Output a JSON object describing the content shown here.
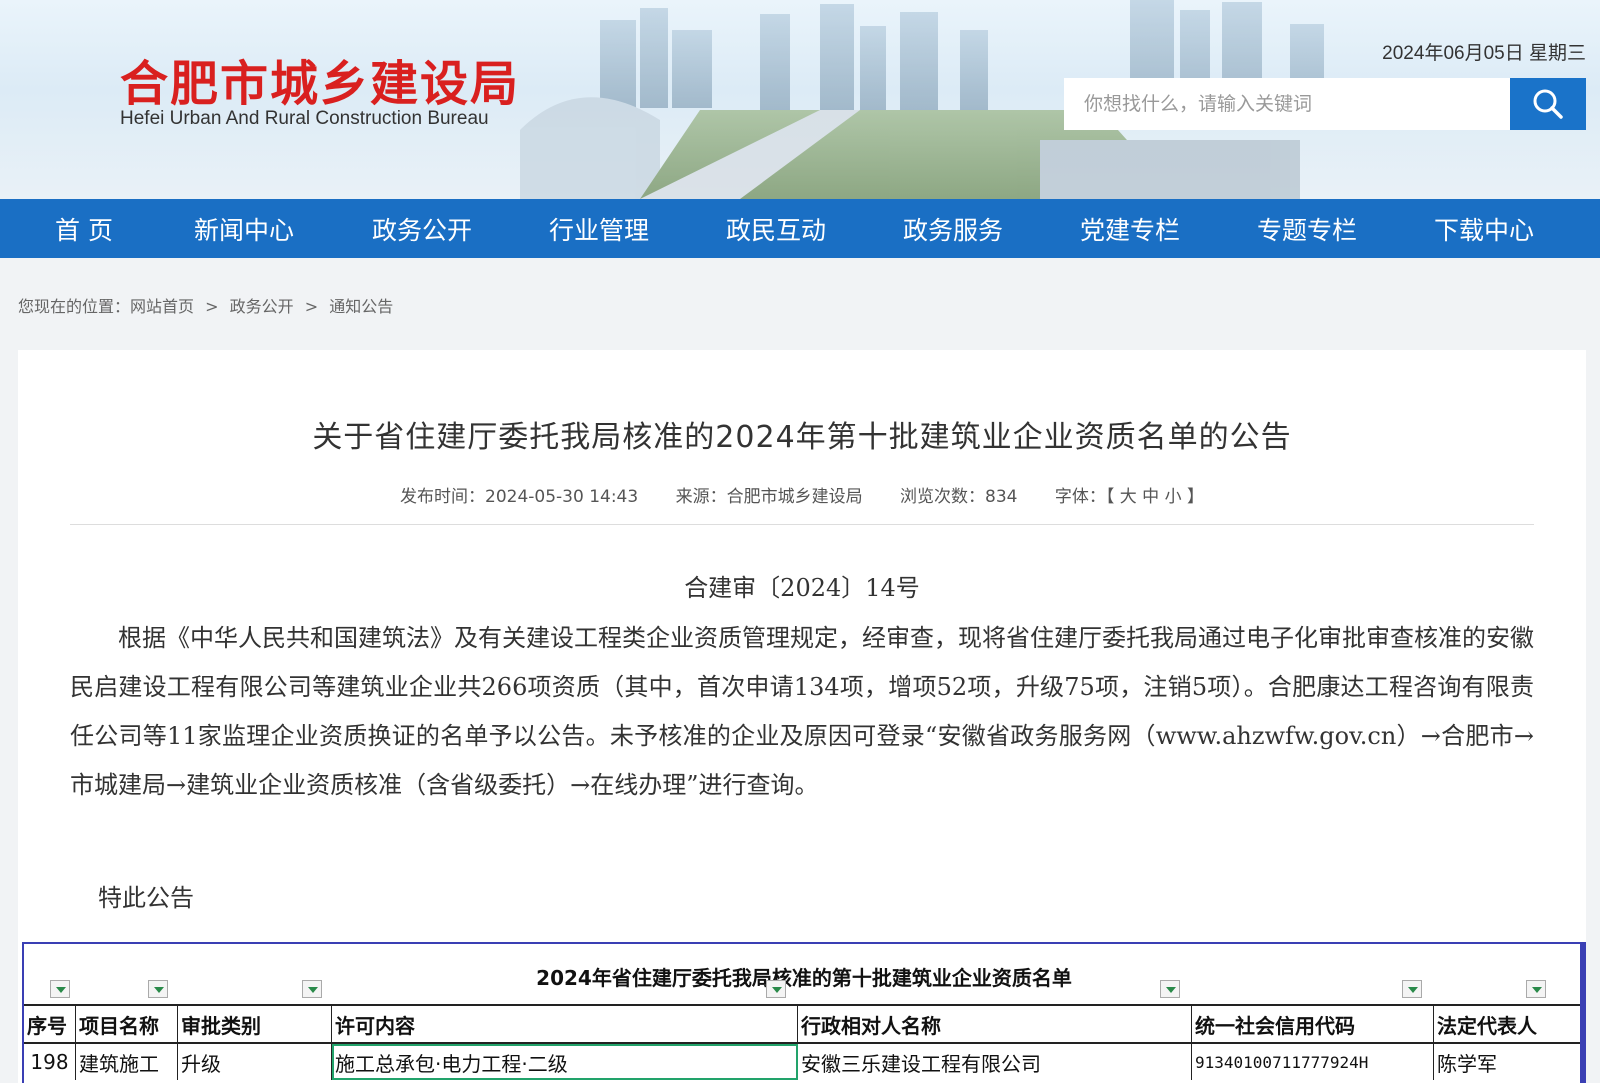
{
  "header": {
    "logo_cn": "合肥市城乡建设局",
    "logo_en": "Hefei Urban And Rural Construction Bureau",
    "date": "2024年06月05日 星期三",
    "search_placeholder": "你想找什么，请输入关键词",
    "search_icon": "search-icon"
  },
  "nav": {
    "items": [
      "首 页",
      "新闻中心",
      "政务公开",
      "行业管理",
      "政民互动",
      "政务服务",
      "党建专栏",
      "专题专栏",
      "下载中心"
    ]
  },
  "breadcrumb": {
    "items": [
      "您现在的位置：网站首页",
      ">",
      "政务公开",
      ">",
      "通知公告"
    ]
  },
  "article": {
    "title": "关于省住建厅委托我局核准的2024年第十批建筑业企业资质名单的公告",
    "publish_time": "发布时间：2024-05-30 14:43",
    "source": "来源：合肥市城乡建设局",
    "views": "浏览次数：834",
    "font_label": "字体：【 大 中 小 】",
    "doc_number": "合建审〔2024〕14号",
    "paragraph": "根据《中华人民共和国建筑法》及有关建设工程类企业资质管理规定，经审查，现将省住建厅委托我局通过电子化审批审查核准的安徽民启建设工程有限公司等建筑业企业共266项资质（其中，首次申请134项，增项52项，升级75项，注销5项）。合肥康达工程咨询有限责任公司等11家监理企业资质换证的名单予以公告。未予核准的企业及原因可登录“安徽省政务服务网（www.ahzwfw.gov.cn）→合肥市→市城建局→建筑业企业资质核准（含省级委托）→在线办理”进行查询。",
    "closing": "特此公告"
  },
  "sheet": {
    "title": "2024年省住建厅委托我局核准的第十批建筑业企业资质名单",
    "columns": [
      "序号",
      "项目名称",
      "审批类别",
      "许可内容",
      "行政相对人名称",
      "统一社会信用代码",
      "法定代表人"
    ],
    "rows": [
      [
        "198",
        "建筑施工",
        "升级",
        "施工总承包·电力工程·二级",
        "安徽三乐建设工程有限公司",
        "91340100711777924H",
        "陈学军"
      ]
    ],
    "accent_color": "#3a3fb4",
    "selection_color": "#22a36b"
  }
}
